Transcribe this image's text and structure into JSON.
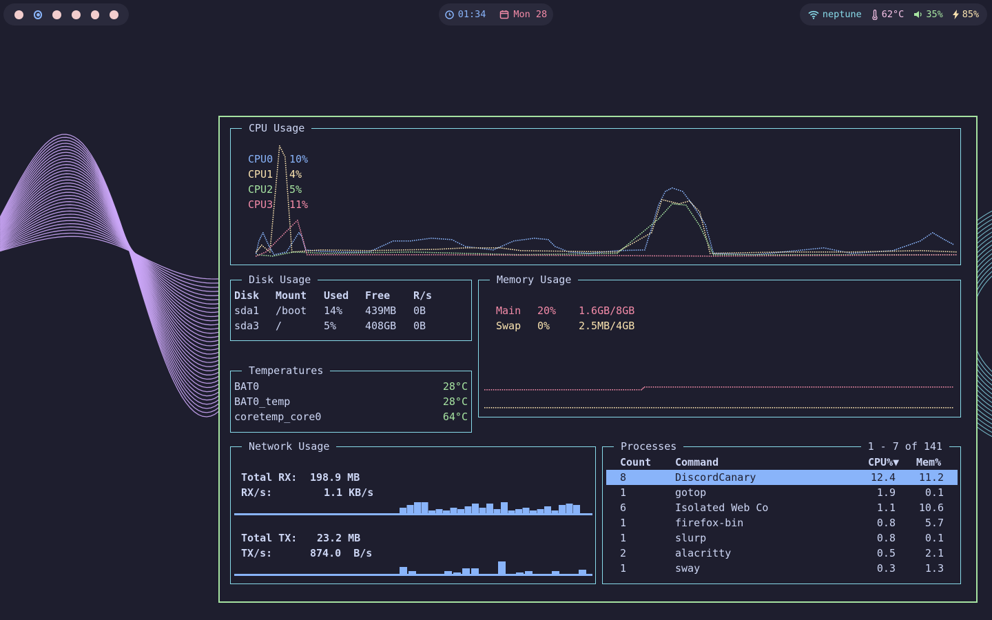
{
  "colors": {
    "background": "#1e1e2e",
    "terminal_border": "#a6e3a1",
    "panel_border": "#89dceb",
    "wave_left": "#cba6f7",
    "wave_right": "#89dceb",
    "accent_blue": "#89b4fa"
  },
  "topbar": {
    "workspaces": {
      "count": 6,
      "active_index": 1
    },
    "clock": {
      "icon": "clock-icon",
      "time": "01:34",
      "date_icon": "calendar-icon",
      "date": "Mon 28"
    },
    "status": {
      "wifi_icon": "wifi-icon",
      "hostname": "neptune",
      "temp_icon": "thermometer-icon",
      "temperature": "62°C",
      "volume_icon": "speaker-icon",
      "volume": "35%",
      "battery_icon": "bolt-icon",
      "battery": "85%"
    }
  },
  "cpu": {
    "title": "CPU Usage",
    "cores": [
      {
        "label": "CPU0",
        "value": "10%",
        "color": "#89b4fa"
      },
      {
        "label": "CPU1",
        "value": "4%",
        "color": "#f9e2af"
      },
      {
        "label": "CPU2",
        "value": "5%",
        "color": "#a6e3a1"
      },
      {
        "label": "CPU3",
        "value": "11%",
        "color": "#f38ba8"
      }
    ]
  },
  "disk": {
    "title": "Disk Usage",
    "headers": [
      "Disk",
      "Mount",
      "Used",
      "Free",
      "R/s"
    ],
    "rows": [
      [
        "sda1",
        "/boot",
        "14%",
        "439MB",
        "0B"
      ],
      [
        "sda3",
        "/",
        "5%",
        "408GB",
        "0B"
      ]
    ]
  },
  "temperatures": {
    "title": "Temperatures",
    "rows": [
      {
        "name": "BAT0",
        "value": "28°C"
      },
      {
        "name": "BAT0_temp",
        "value": "28°C"
      },
      {
        "name": "coretemp_core0",
        "value": "64°C"
      }
    ]
  },
  "memory": {
    "title": "Memory Usage",
    "rows": [
      {
        "name": "Main",
        "percent": "20%",
        "amount": "1.6GB/8GB",
        "color": "#f38ba8"
      },
      {
        "name": "Swap",
        "percent": "0%",
        "amount": "2.5MB/4GB",
        "color": "#f9e2af"
      }
    ]
  },
  "network": {
    "title": "Network Usage",
    "rx_total_label": "Total RX:",
    "rx_total": "198.9 MB",
    "rx_rate_label": "RX/s:",
    "rx_rate": "1.1 KB/s",
    "tx_total_label": "Total TX:",
    "tx_total": "23.2 MB",
    "tx_rate_label": "TX/s:",
    "tx_rate": "874.0  B/s"
  },
  "processes": {
    "title": "Processes",
    "range": "1 - 7 of 141",
    "headers": {
      "count": "Count",
      "command": "Command",
      "cpu": "CPU%▼",
      "mem": "Mem%"
    },
    "rows": [
      {
        "count": "8",
        "command": "DiscordCanary",
        "cpu": "12.4",
        "mem": "11.2"
      },
      {
        "count": "1",
        "command": "gotop",
        "cpu": "1.9",
        "mem": "0.1"
      },
      {
        "count": "6",
        "command": "Isolated Web Co",
        "cpu": "1.1",
        "mem": "10.6"
      },
      {
        "count": "1",
        "command": "firefox-bin",
        "cpu": "0.8",
        "mem": "5.7"
      },
      {
        "count": "1",
        "command": "slurp",
        "cpu": "0.8",
        "mem": "0.1"
      },
      {
        "count": "2",
        "command": "alacritty",
        "cpu": "0.5",
        "mem": "2.1"
      },
      {
        "count": "1",
        "command": "sway",
        "cpu": "0.3",
        "mem": "1.3"
      }
    ]
  }
}
